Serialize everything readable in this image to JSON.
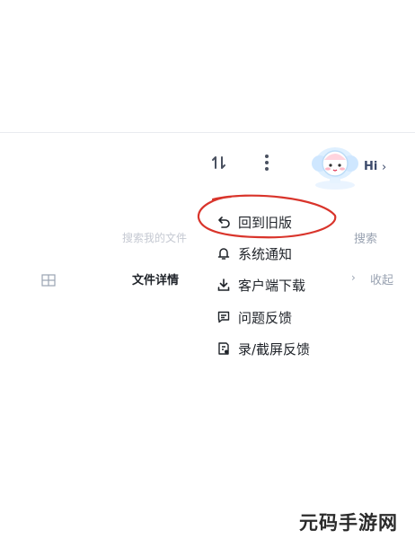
{
  "header": {
    "sort_icon": "sort-icon",
    "more_icon": "more-vertical-icon",
    "avatar_icon": "cloud-mascot-avatar",
    "greeting": "Hi"
  },
  "background": {
    "search_placeholder": "搜索我的文件",
    "search_button": "搜索",
    "file_detail_title": "文件详情",
    "collapse_label": "收起"
  },
  "menu": {
    "items": [
      {
        "label": "回到旧版",
        "icon": "undo-icon"
      },
      {
        "label": "系统通知",
        "icon": "bell-icon"
      },
      {
        "label": "客户端下载",
        "icon": "download-icon"
      },
      {
        "label": "问题反馈",
        "icon": "message-icon"
      },
      {
        "label": "录/截屏反馈",
        "icon": "screen-record-icon"
      }
    ],
    "highlight_color": "#d9342b"
  },
  "watermark": {
    "text": "元码手游网"
  }
}
